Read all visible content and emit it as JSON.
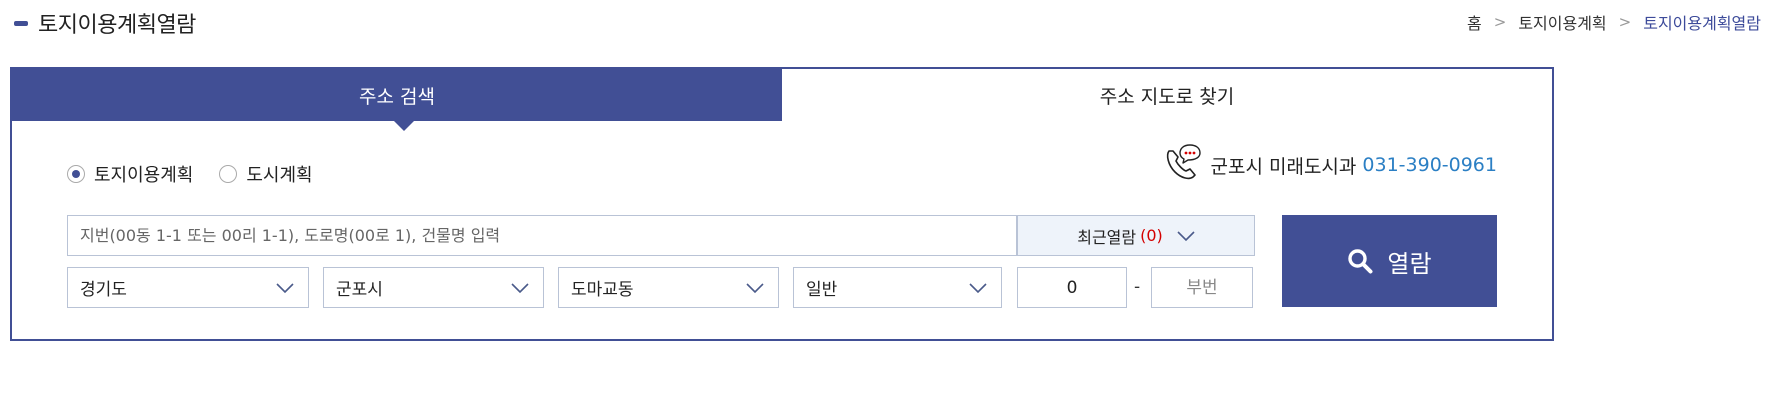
{
  "page_title": "토지이용계획열람",
  "breadcrumb": {
    "home": "홈",
    "parent": "토지이용계획",
    "current": "토지이용계획열람"
  },
  "tabs": {
    "address_search": "주소 검색",
    "map_search": "주소 지도로 찾기"
  },
  "radios": {
    "land_use": "토지이용계획",
    "city_plan": "도시계획",
    "selected": "land_use"
  },
  "contact": {
    "dept": "군포시 미래도시과",
    "phone": "031-390-0961"
  },
  "search": {
    "placeholder": "지번(00동 1-1 또는 00리 1-1), 도로명(00로 1), 건물명 입력",
    "value": ""
  },
  "recent": {
    "label": "최근열람",
    "count": "(0)"
  },
  "selects": {
    "province": "경기도",
    "city": "군포시",
    "district": "도마교동",
    "land_type": "일반"
  },
  "lot": {
    "main": "0",
    "dash": "-",
    "sub_placeholder": "부번"
  },
  "view_button": "열람",
  "colors": {
    "primary": "#414f95",
    "phone": "#2b7fc4",
    "count": "#d40000",
    "recent_bg": "#eef3fa"
  }
}
